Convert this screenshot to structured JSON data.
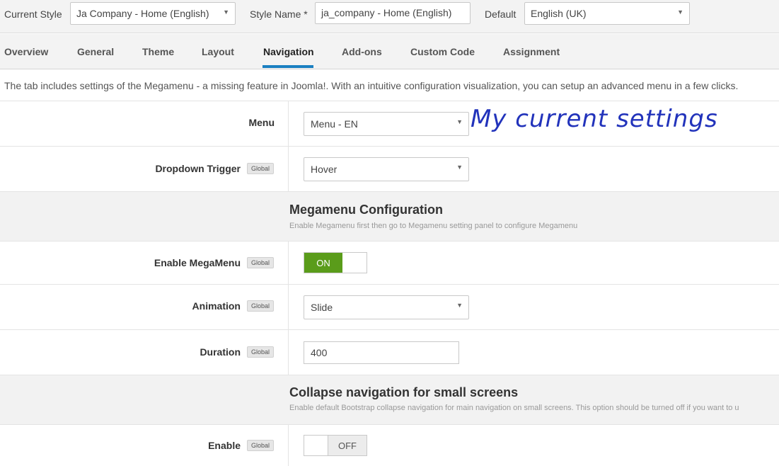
{
  "style_bar": {
    "current_style_label": "Current Style",
    "current_style_value": "Ja Company - Home (English)",
    "style_name_label": "Style Name *",
    "style_name_value": "ja_company - Home (English)",
    "default_label": "Default",
    "default_value": "English (UK)"
  },
  "tabs": [
    {
      "label": "Overview"
    },
    {
      "label": "General"
    },
    {
      "label": "Theme"
    },
    {
      "label": "Layout"
    },
    {
      "label": "Navigation",
      "active": true
    },
    {
      "label": "Add-ons"
    },
    {
      "label": "Custom Code"
    },
    {
      "label": "Assignment"
    }
  ],
  "intro": "The tab includes settings of the Megamenu - a missing feature in Joomla!. With an intuitive configuration visualization, you can setup an advanced menu in a few clicks.",
  "annotation": "My current settings",
  "badge_label": "Global",
  "fields": {
    "menu": {
      "label": "Menu",
      "value": "Menu - EN"
    },
    "dropdown_trigger": {
      "label": "Dropdown Trigger",
      "value": "Hover"
    },
    "enable_megamenu": {
      "label": "Enable MegaMenu",
      "value": "ON"
    },
    "animation": {
      "label": "Animation",
      "value": "Slide"
    },
    "duration": {
      "label": "Duration",
      "value": "400"
    },
    "enable_collapse": {
      "label": "Enable",
      "value": "OFF"
    }
  },
  "sections": {
    "megamenu": {
      "title": "Megamenu Configuration",
      "desc": "Enable Megamenu first then go to Megamenu setting panel to configure Megamenu"
    },
    "collapse": {
      "title": "Collapse navigation for small screens",
      "desc": "Enable default Bootstrap collapse navigation for main navigation on small screens. This option should be turned off if you want to u"
    }
  },
  "colors": {
    "accent": "#1a7fc1",
    "toggle_on": "#5a9c1a",
    "annotation": "#2233bb"
  }
}
